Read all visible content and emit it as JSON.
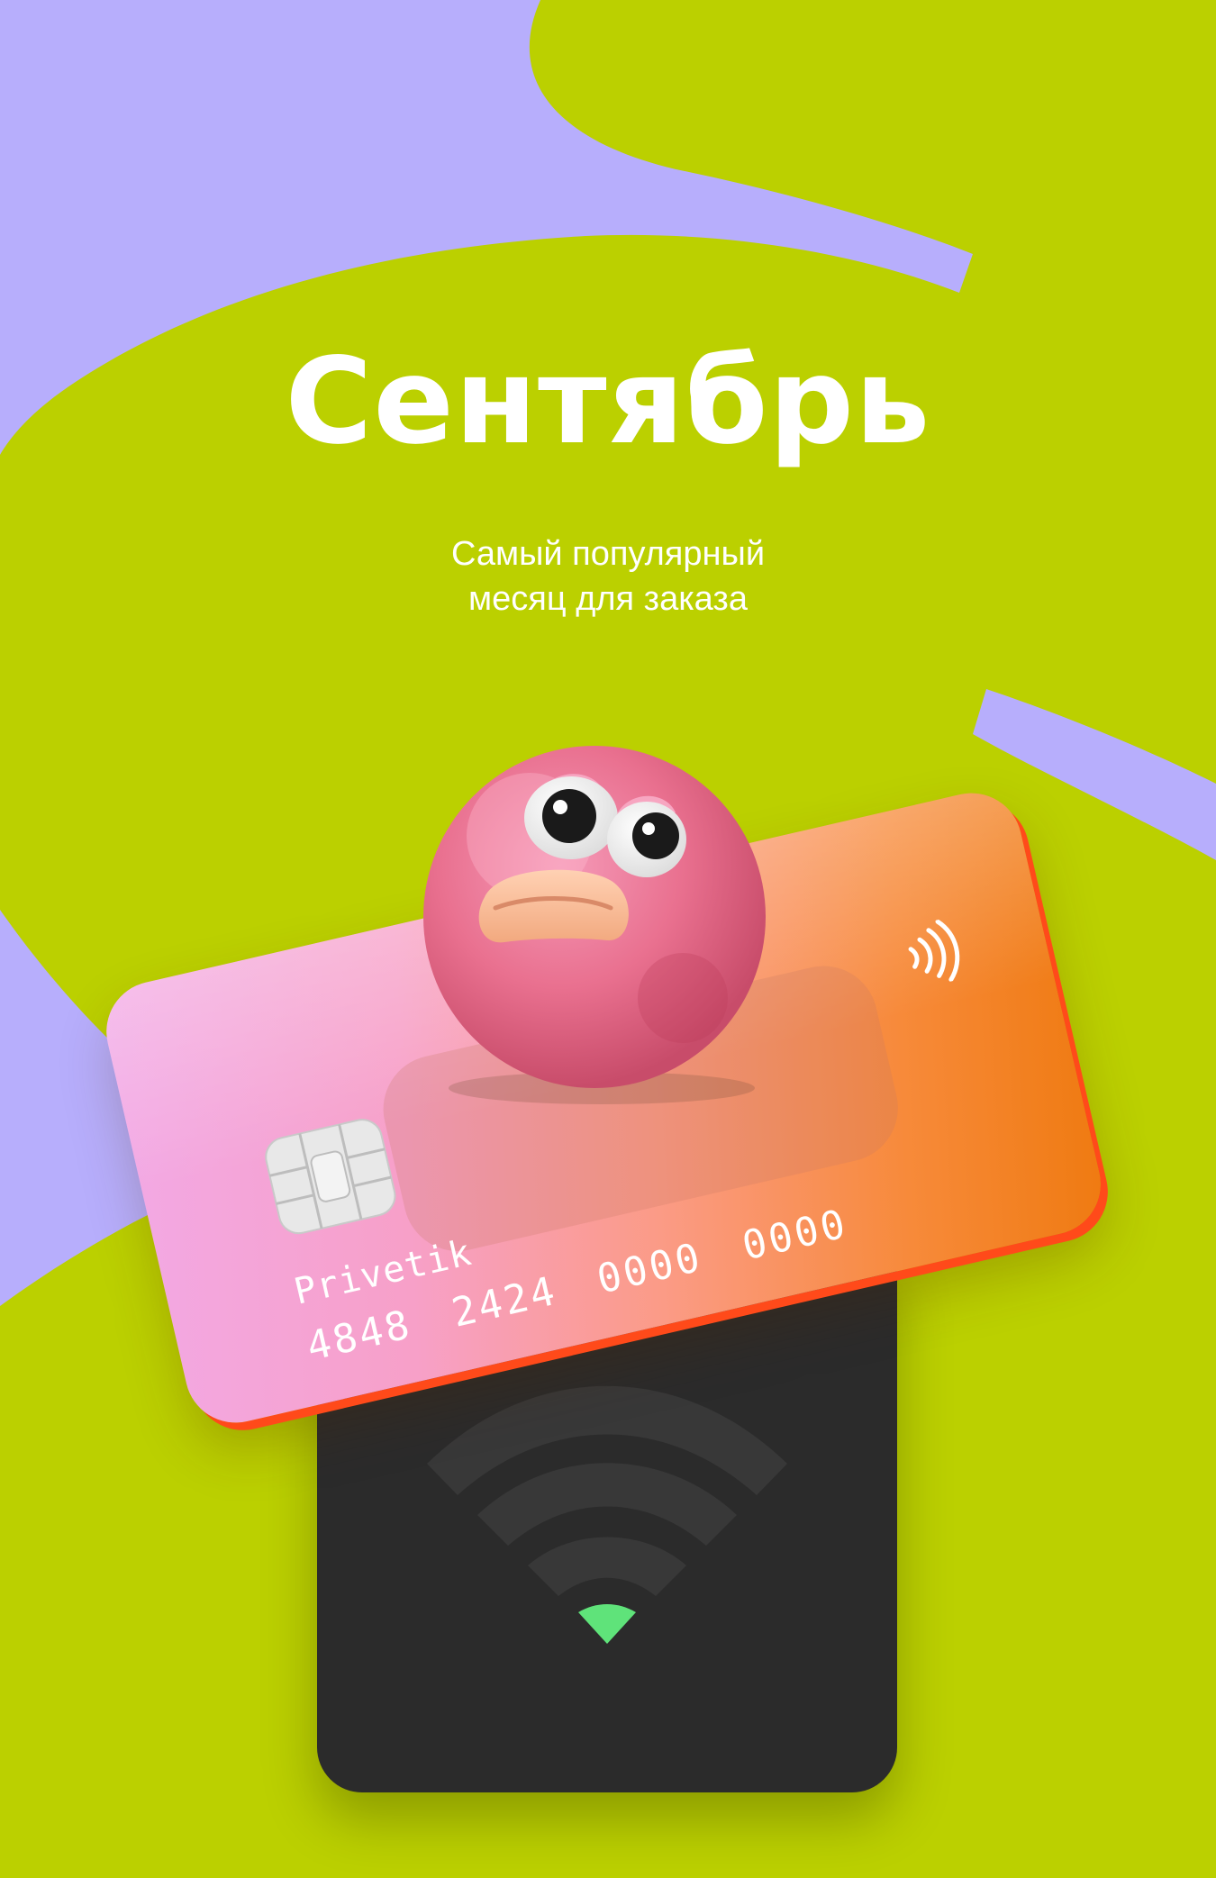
{
  "title": "Сентябрь",
  "subtitle": [
    "Самый популярный",
    "месяц для заказа"
  ],
  "card": {
    "holder_name": "Privetik",
    "number": "4848 2424 0000 0000"
  },
  "colors": {
    "background": "#bbd000",
    "accent_shape": "#b7aefc",
    "text": "#ffffff",
    "reader": "#2b2b2b",
    "reader_indicator": "#5fe37a"
  },
  "icons": {
    "contactless": "contactless-icon",
    "chip": "card-chip-icon",
    "wireless": "wireless-signal-icon"
  }
}
